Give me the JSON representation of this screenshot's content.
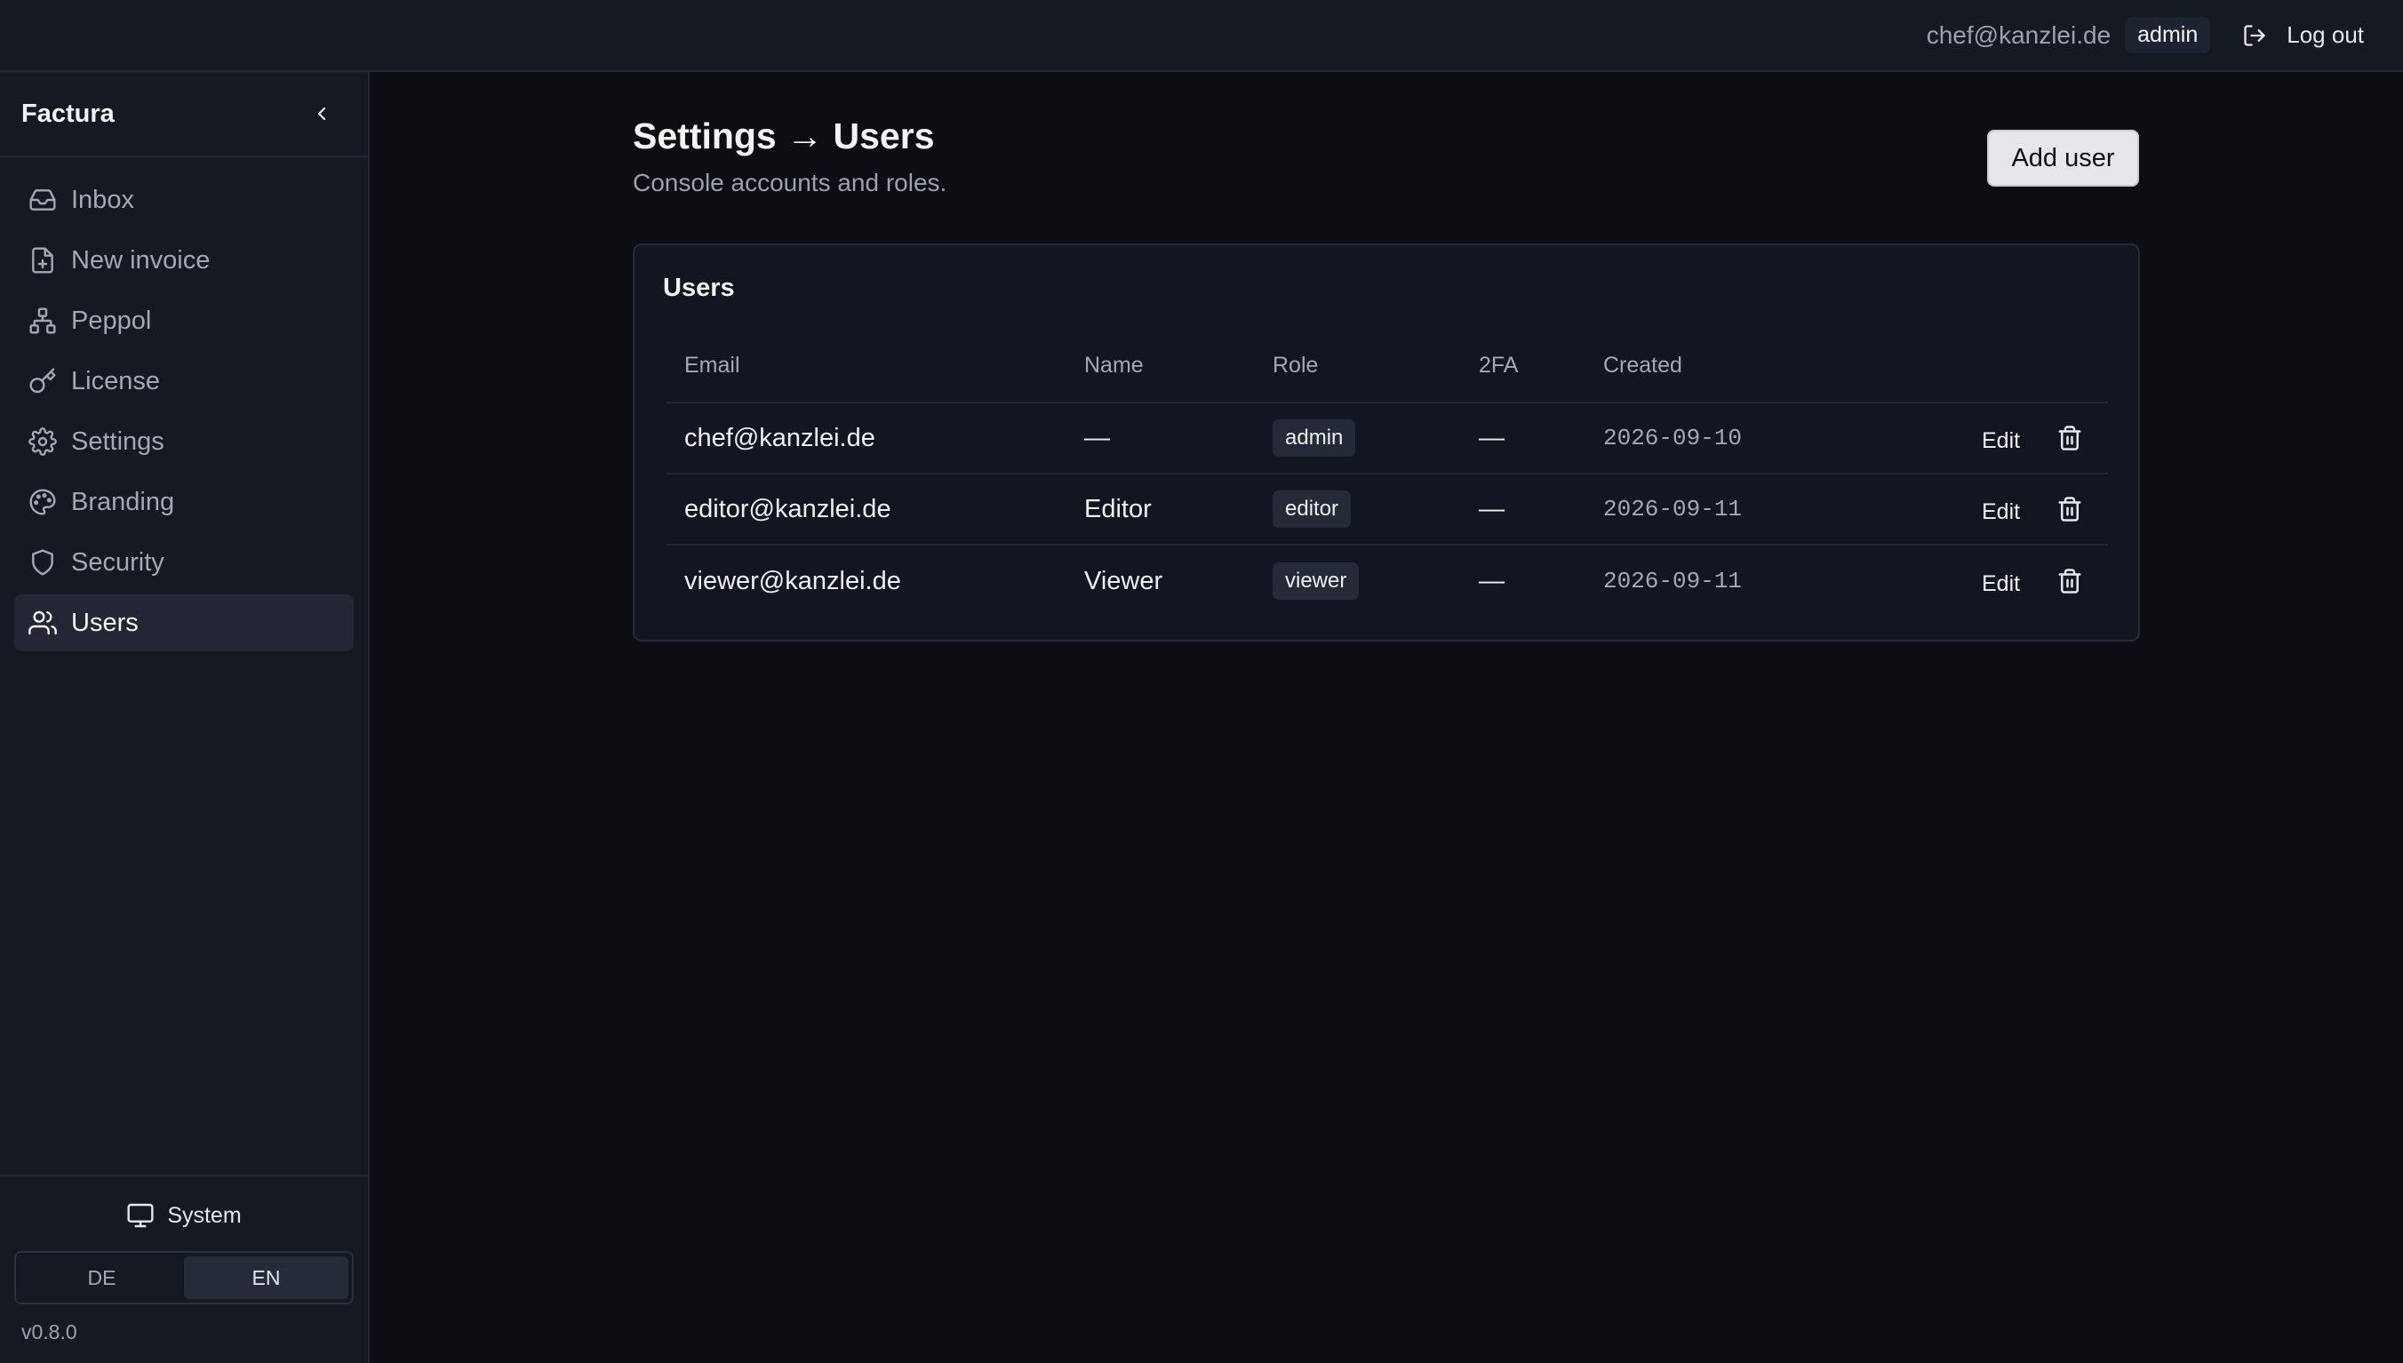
{
  "topbar": {
    "user_email": "chef@kanzlei.de",
    "user_role": "admin",
    "logout_label": "Log out"
  },
  "sidebar": {
    "brand": "Factura",
    "items": [
      {
        "label": "Inbox",
        "icon": "inbox-icon"
      },
      {
        "label": "New invoice",
        "icon": "file-plus-icon"
      },
      {
        "label": "Peppol",
        "icon": "network-icon"
      },
      {
        "label": "License",
        "icon": "key-icon"
      },
      {
        "label": "Settings",
        "icon": "gear-icon"
      },
      {
        "label": "Branding",
        "icon": "palette-icon"
      },
      {
        "label": "Security",
        "icon": "shield-icon"
      },
      {
        "label": "Users",
        "icon": "users-icon",
        "active": true
      }
    ],
    "theme_label": "System",
    "languages": [
      "DE",
      "EN"
    ],
    "active_language": "EN",
    "version": "v0.8.0"
  },
  "main": {
    "title": "Settings → Users",
    "subtitle": "Console accounts and roles.",
    "add_button": "Add user",
    "card_title": "Users",
    "columns": [
      "Email",
      "Name",
      "Role",
      "2FA",
      "Created"
    ],
    "rows": [
      {
        "email": "chef@kanzlei.de",
        "name": "—",
        "role": "admin",
        "twofa": "—",
        "created": "2026-09-10",
        "edit": "Edit"
      },
      {
        "email": "editor@kanzlei.de",
        "name": "Editor",
        "role": "editor",
        "twofa": "—",
        "created": "2026-09-11",
        "edit": "Edit"
      },
      {
        "email": "viewer@kanzlei.de",
        "name": "Viewer",
        "role": "viewer",
        "twofa": "—",
        "created": "2026-09-11",
        "edit": "Edit"
      }
    ]
  },
  "colors": {
    "background": "#0c0e13",
    "panel": "#151922",
    "accent_button": "#e5e7eb"
  }
}
